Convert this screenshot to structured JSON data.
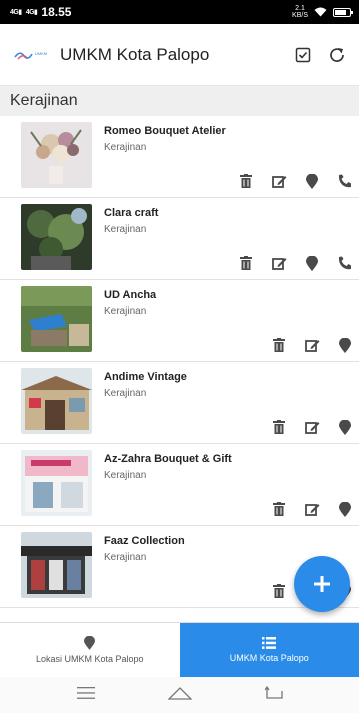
{
  "status_bar": {
    "signal": "4G",
    "time": "18.55",
    "net_speed": "2.1",
    "net_unit": "KB/S",
    "battery_level": 0.75
  },
  "app_bar": {
    "logo_text": "UMKM",
    "title": "UMKM Kota Palopo"
  },
  "section": {
    "title": "Kerajinan"
  },
  "items": [
    {
      "name": "Romeo Bouquet Atelier",
      "category": "Kerajinan"
    },
    {
      "name": "Clara craft",
      "category": "Kerajinan"
    },
    {
      "name": "UD Ancha",
      "category": "Kerajinan"
    },
    {
      "name": "Andime Vintage",
      "category": "Kerajinan"
    },
    {
      "name": "Az-Zahra Bouquet & Gift",
      "category": "Kerajinan"
    },
    {
      "name": "Faaz Collection",
      "category": "Kerajinan"
    }
  ],
  "fab": {
    "icon": "plus-icon"
  },
  "bottom_nav": {
    "map_label": "Lokasi UMKM Kota Palopo",
    "list_label": "UMKM Kota Palopo"
  },
  "colors": {
    "accent": "#2a8ce8",
    "icon": "#4a4a4a",
    "section_bg": "#efefef"
  }
}
